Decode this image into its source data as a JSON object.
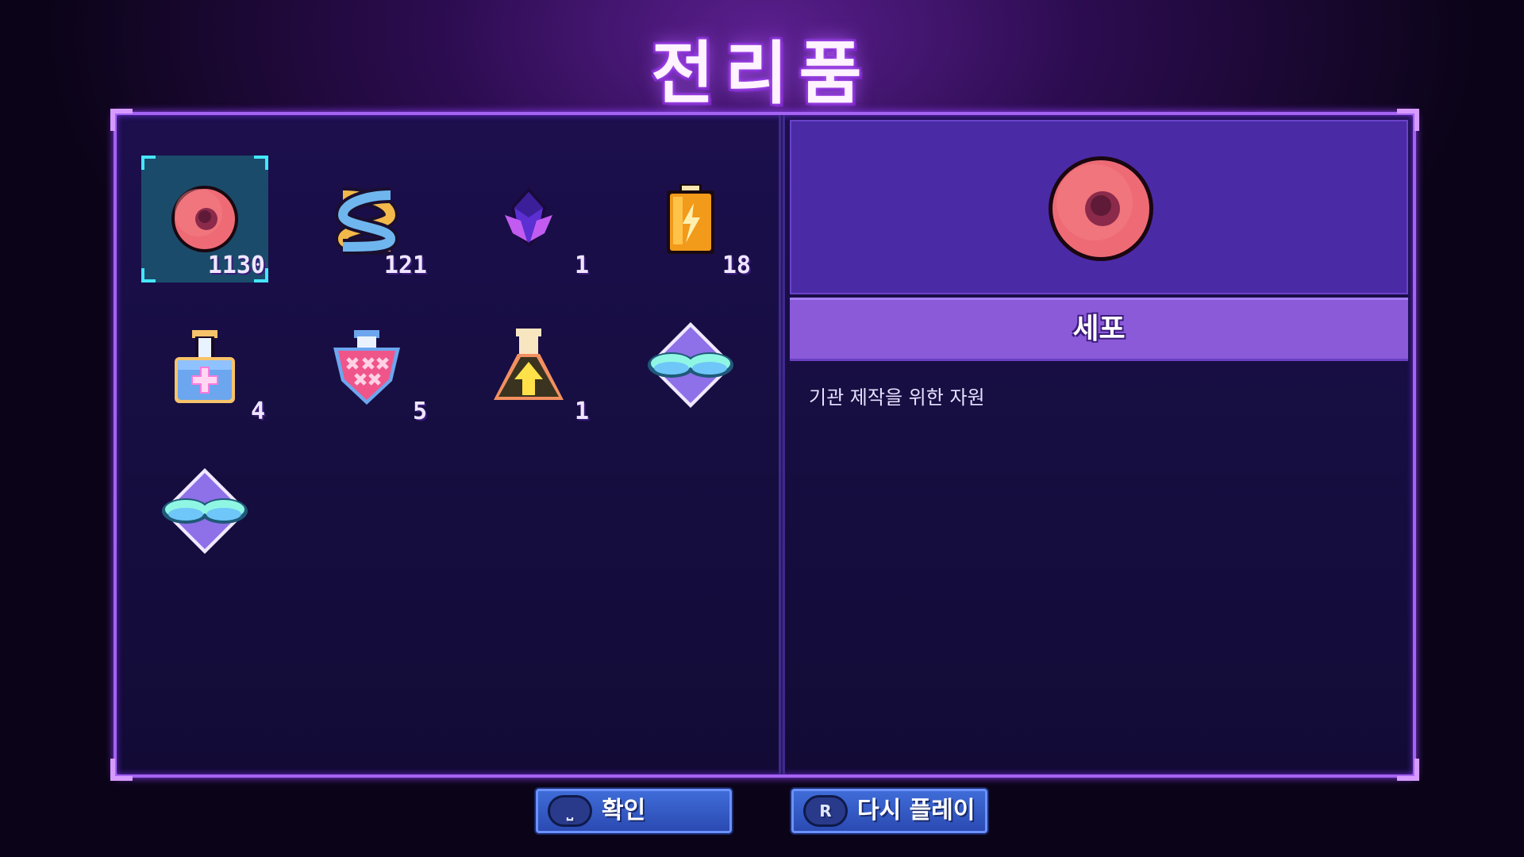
{
  "screen_title": "전리품",
  "inventory": [
    {
      "icon": "cell-icon",
      "count": "1130",
      "selected": true
    },
    {
      "icon": "dna-icon",
      "count": "121"
    },
    {
      "icon": "purple-crystal-icon",
      "count": "1"
    },
    {
      "icon": "battery-icon",
      "count": "18"
    },
    {
      "icon": "health-potion-icon",
      "count": "4"
    },
    {
      "icon": "poison-potion-icon",
      "count": "5"
    },
    {
      "icon": "upgrade-flask-icon",
      "count": "1"
    },
    {
      "icon": "wing-gem-icon",
      "count": ""
    },
    {
      "icon": "wing-gem-icon",
      "count": ""
    }
  ],
  "detail": {
    "icon": "cell-icon",
    "name": "세포",
    "description": "기관 제작을 위한 자원"
  },
  "buttons": {
    "confirm": {
      "key": "⎵",
      "label": "확인"
    },
    "replay": {
      "key": "R",
      "label": "다시 플레이"
    }
  },
  "colors": {
    "frame": "#a463f2",
    "selection": "#45e6ff",
    "button": "#3f6cd8"
  }
}
